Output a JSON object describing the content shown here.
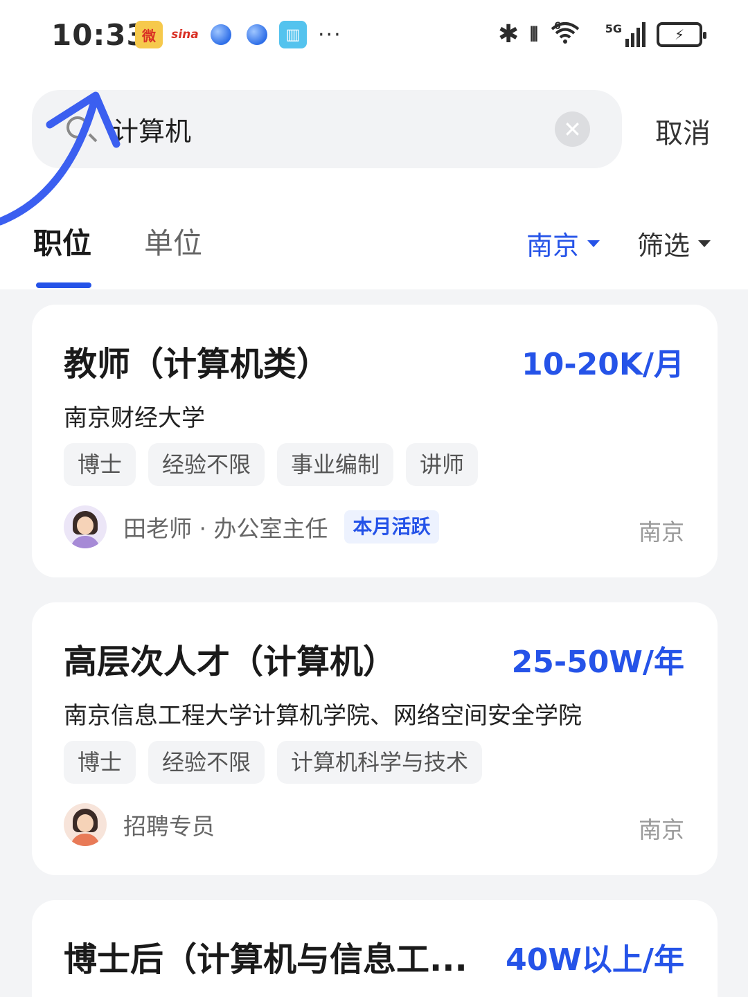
{
  "status_bar": {
    "time": "10:33",
    "app_icons": [
      {
        "name": "weibo-icon",
        "glyph": "微"
      },
      {
        "name": "sina-icon",
        "glyph": "sina"
      },
      {
        "name": "planet-icon",
        "glyph": ""
      },
      {
        "name": "planet-icon",
        "glyph": ""
      },
      {
        "name": "book-icon",
        "glyph": "▥"
      }
    ],
    "more": "···",
    "bluetooth": "∦",
    "vibrate": "⫴",
    "wifi": "6",
    "network": "5G",
    "battery": "⚡"
  },
  "search": {
    "query": "计算机",
    "cancel_label": "取消",
    "clear_glyph": "✕"
  },
  "tabs": {
    "job": "职位",
    "org": "单位"
  },
  "filters": {
    "city": "南京",
    "screen": "筛选"
  },
  "colors": {
    "accent": "#2553e8",
    "annotation_arrow": "#3b5ff0"
  },
  "jobs": [
    {
      "title": "教师（计算机类）",
      "salary": "10-20K/月",
      "org": "南京财经大学",
      "tags": [
        "博士",
        "经验不限",
        "事业编制",
        "讲师"
      ],
      "recruiter": "田老师 · 办公室主任",
      "badge": "本月活跃",
      "city": "南京"
    },
    {
      "title": "高层次人才（计算机）",
      "salary": "25-50W/年",
      "org": "南京信息工程大学计算机学院、网络空间安全学院",
      "tags": [
        "博士",
        "经验不限",
        "计算机科学与技术"
      ],
      "recruiter": "招聘专员",
      "city": "南京"
    },
    {
      "title": "博士后（计算机与信息工...",
      "salary": "40W以上/年"
    }
  ]
}
